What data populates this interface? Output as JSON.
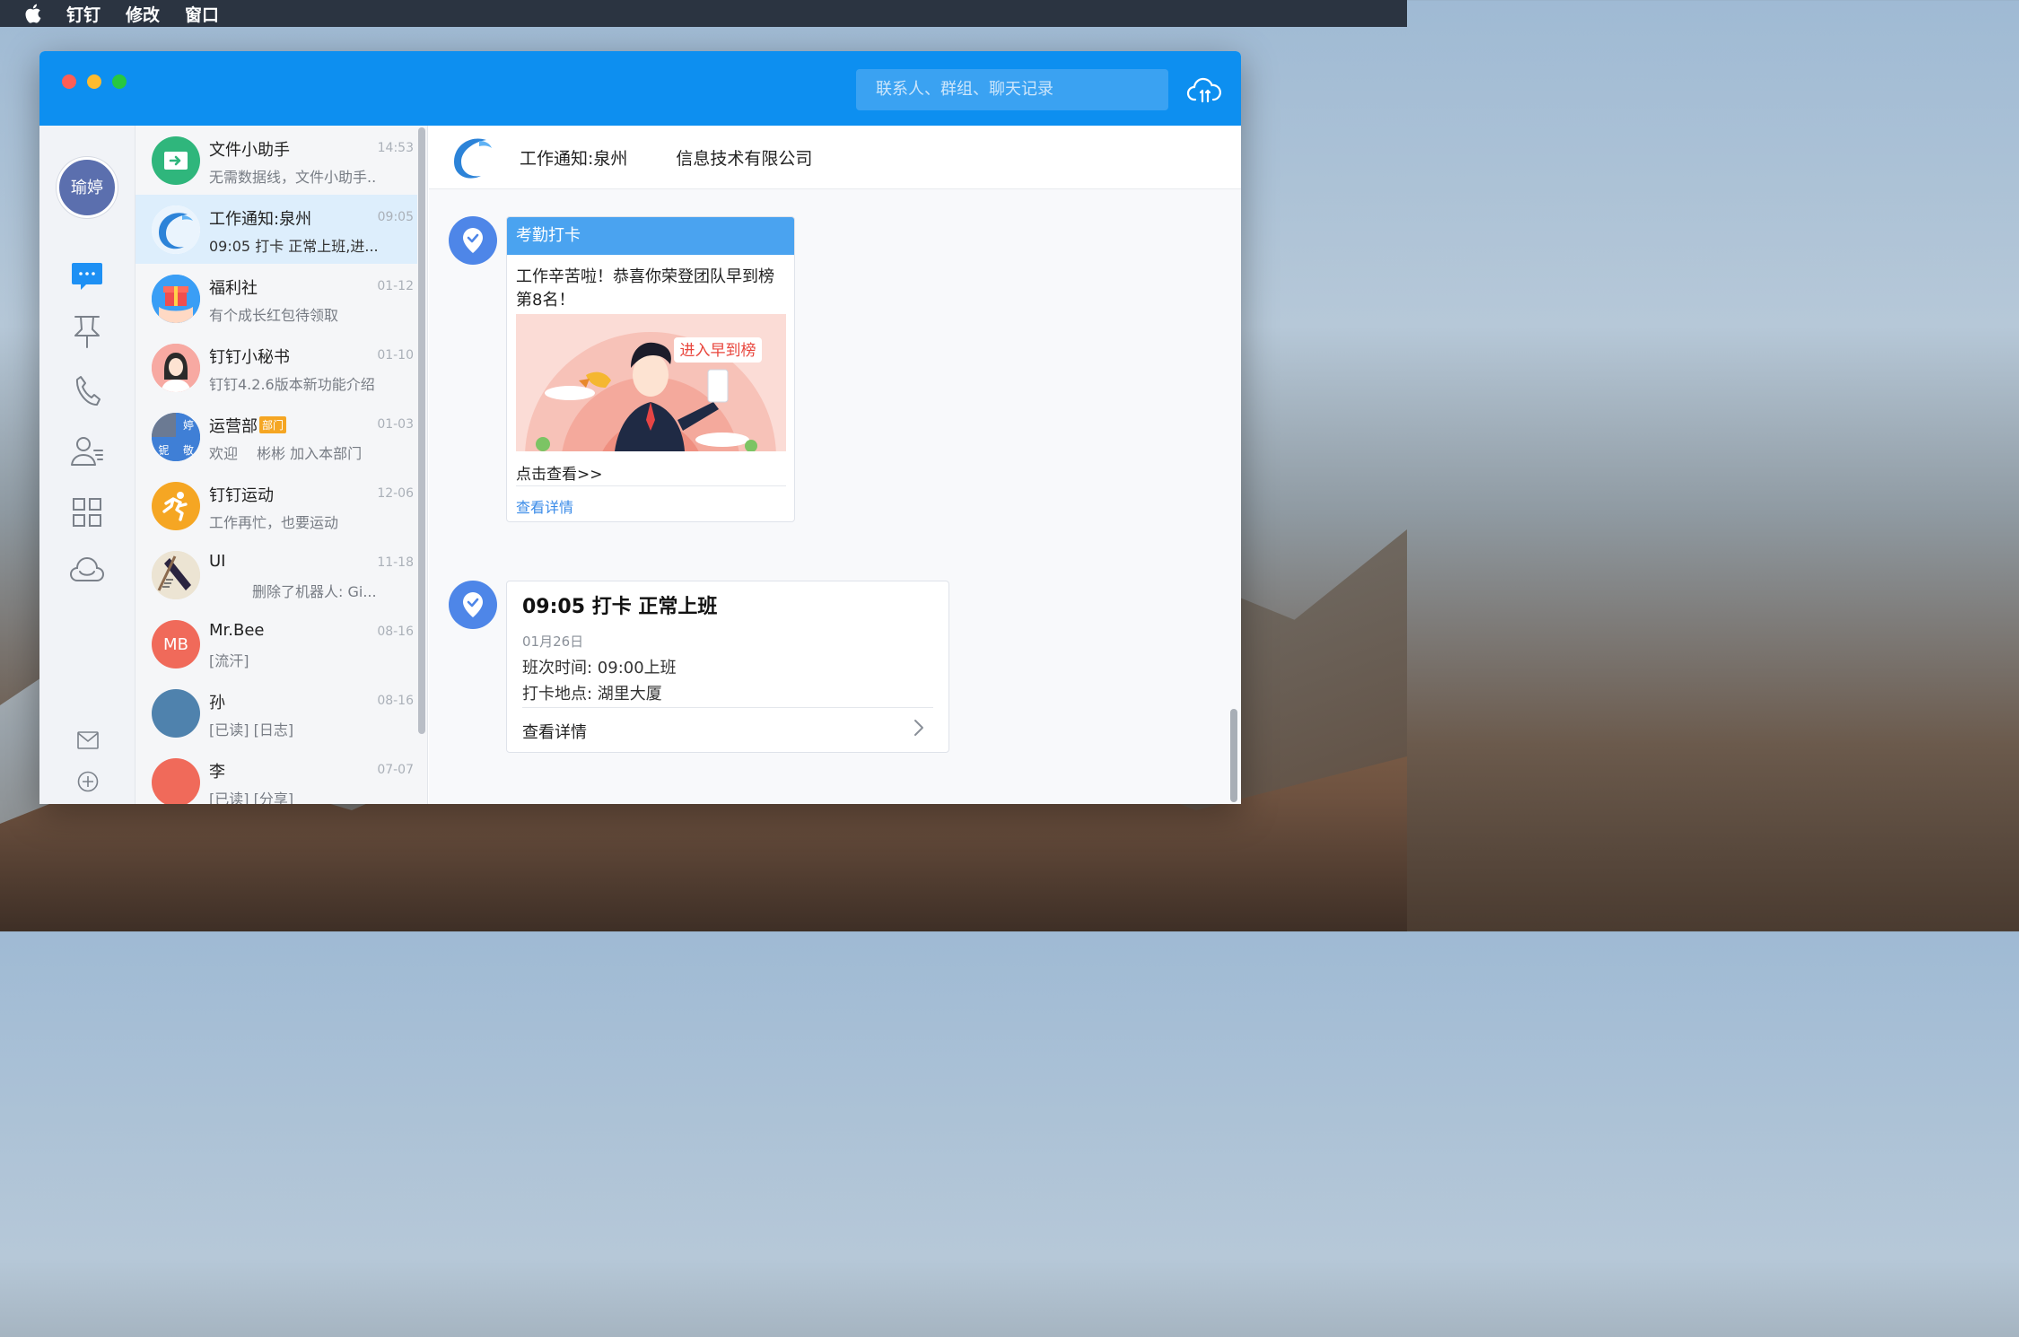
{
  "menubar": {
    "items": [
      "钉钉",
      "修改",
      "窗口"
    ]
  },
  "titlebar": {
    "search_placeholder": "联系人、群组、聊天记录"
  },
  "nav": {
    "avatar_label": "瑜婷"
  },
  "conversations": [
    {
      "name": "文件小助手",
      "time": "14:53",
      "preview": "无需数据线，文件小助手..",
      "avatar_color": "#2fb67c",
      "icon": "file-transfer-icon"
    },
    {
      "name": "工作通知:泉州",
      "time": "09:05",
      "preview": "09:05 打卡 正常上班,进...",
      "avatar_color": "#ffffff",
      "icon": "work-notice-icon",
      "active": true
    },
    {
      "name": "福利社",
      "time": "01-12",
      "preview": "有个成长红包待领取",
      "avatar_color": "#3a9ef5",
      "icon": "gift-icon"
    },
    {
      "name": "钉钉小秘书",
      "time": "01-10",
      "preview": "钉钉4.2.6版本新功能介绍",
      "avatar_color": "#f29a9a",
      "icon": "secretary-avatar-icon"
    },
    {
      "name": "运营部",
      "tag": "部门",
      "time": "01-03",
      "preview": "欢迎　 彬彬 加入本部门",
      "avatar_color": "#3f7fd6",
      "icon": "group-avatar-icon",
      "group_chars": [
        "婷",
        "铌",
        "敬"
      ]
    },
    {
      "name": "钉钉运动",
      "time": "12-06",
      "preview": "工作再忙，也要运动",
      "avatar_color": "#f5a623",
      "icon": "running-icon"
    },
    {
      "name": "UI",
      "time": "11-18",
      "preview": "　　　删除了机器人: Gi...",
      "avatar_color": "#e9e1cf",
      "icon": "ui-group-icon"
    },
    {
      "name": "Mr.Bee",
      "time": "08-16",
      "preview": "[流汗]",
      "avatar_color": "#f06a5a",
      "icon": "initials-avatar",
      "initials": "MB"
    },
    {
      "name": "孙",
      "time": "08-16",
      "preview": "[已读] [日志]",
      "avatar_color": "#4f82ad",
      "icon": "contact-avatar"
    },
    {
      "name": "李",
      "time": "07-07",
      "preview": "[已读] [分享]",
      "avatar_color": "#f06a5a",
      "icon": "contact-avatar"
    }
  ],
  "chat": {
    "title_part1": "工作通知:泉州",
    "title_part2": "信息技术有限公司",
    "card1": {
      "header": "考勤打卡",
      "text": "工作辛苦啦！恭喜你荣登团队早到榜第8名！",
      "image_badge": "进入早到榜",
      "link": "点击查看>>",
      "detail": "查看详情"
    },
    "card2": {
      "title": "09:05 打卡 正常上班",
      "date": "01月26日",
      "shift": "班次时间: 09:00上班",
      "location": "打卡地点: 湖里大厦",
      "detail": "查看详情"
    }
  },
  "colors": {
    "titlebar": "#0d8ff0",
    "accent": "#3a8be8",
    "active_row": "#ddeefc"
  }
}
